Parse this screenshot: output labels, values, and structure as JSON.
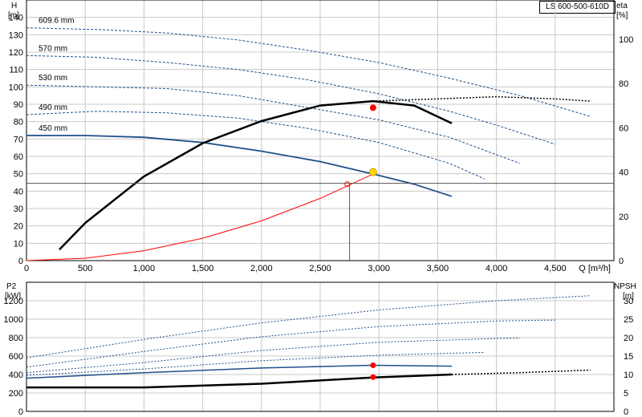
{
  "title": "LS 600-500-610D",
  "colors": {
    "curve": "#1f4f8b",
    "efficiency": "#000000",
    "system_curve": "#ff0000",
    "duty_point": "#ffd700",
    "marker": "#ff0000"
  },
  "chart_data": [
    {
      "type": "line",
      "panel": "head-efficiency",
      "xlabel": "Q [m³/h]",
      "ylabel_left": "H [m]",
      "ylabel_right": "eta [%]",
      "xlim": [
        0,
        5000
      ],
      "ylim_left": [
        0,
        150
      ],
      "ylim_right": [
        0,
        100
      ],
      "xticks": [
        "0",
        "500",
        "1,000",
        "1,500",
        "2,000",
        "2,500",
        "3,000",
        "3,500",
        "4,000",
        "4,500"
      ],
      "xtick_values": [
        0,
        500,
        1000,
        1500,
        2000,
        2500,
        3000,
        3500,
        4000,
        4500
      ],
      "yticks_left": [
        0,
        10,
        20,
        30,
        40,
        50,
        60,
        70,
        80,
        90,
        100,
        110,
        120,
        130,
        140
      ],
      "yticks_right": [
        0,
        20,
        40,
        60,
        80,
        100
      ],
      "grid": true,
      "impeller_curves": [
        {
          "label": "609.6 mm",
          "x": [
            0,
            600,
            1200,
            1800,
            2400,
            3000,
            3600,
            4200,
            4800
          ],
          "y": [
            134,
            133,
            131,
            127,
            121,
            114,
            105,
            95,
            83
          ]
        },
        {
          "label": "570 mm",
          "x": [
            0,
            600,
            1200,
            1800,
            2400,
            3000,
            3600,
            4000,
            4500
          ],
          "y": [
            118,
            117,
            114,
            110,
            104,
            96,
            86,
            78,
            67
          ]
        },
        {
          "label": "530 mm",
          "x": [
            0,
            600,
            1200,
            1800,
            2400,
            3000,
            3600,
            4200
          ],
          "y": [
            101,
            100,
            99,
            95,
            88,
            81,
            71,
            56
          ]
        },
        {
          "label": "490 mm",
          "x": [
            0,
            600,
            1200,
            1800,
            2400,
            3000,
            3600,
            3900
          ],
          "y": [
            84,
            86,
            85,
            82,
            76,
            68,
            56,
            47
          ]
        },
        {
          "label": "450 mm",
          "x": [
            0,
            500,
            1000,
            1500,
            2000,
            2500,
            3000,
            3300,
            3620
          ],
          "y": [
            72,
            72,
            71,
            68,
            63,
            57,
            49,
            44,
            37
          ]
        }
      ],
      "selected_curve_solid_until": 3620,
      "efficiency_curve": {
        "x": [
          280,
          500,
          1000,
          1500,
          2000,
          2500,
          2950,
          3300,
          3620
        ],
        "y": [
          5,
          17,
          38,
          53,
          63,
          70,
          72,
          70,
          62
        ]
      },
      "efficiency_extension": {
        "x": [
          2950,
          3500,
          4000,
          4500,
          4800
        ],
        "y": [
          72,
          73,
          74,
          73,
          72
        ]
      },
      "system_curve": {
        "x": [
          0,
          500,
          1000,
          1500,
          2000,
          2500,
          2950
        ],
        "y": [
          0,
          1.4,
          5.7,
          12.9,
          22.9,
          35.8,
          49.8
        ]
      },
      "duty_point": {
        "x": 2950,
        "y": 51
      },
      "efficiency_point": {
        "x": 2950,
        "eta": 69
      },
      "system_marker": {
        "x": 2730,
        "y": 44
      },
      "reference_line": {
        "x": 2750,
        "y": 44.5
      }
    },
    {
      "type": "line",
      "panel": "power-npsh",
      "ylabel_left": "P2 [kW]",
      "ylabel_right": "NPSH [m]",
      "xlim": [
        0,
        5000
      ],
      "ylim_left": [
        0,
        1400
      ],
      "ylim_right": [
        0,
        35
      ],
      "yticks_left": [
        0,
        200,
        400,
        600,
        800,
        1000,
        1200
      ],
      "yticks_right": [
        0,
        5,
        10,
        15,
        20,
        25,
        30
      ],
      "grid": true,
      "power_curves": [
        {
          "x": [
            0,
            1000,
            2000,
            3000,
            4000,
            4800
          ],
          "y": [
            580,
            780,
            960,
            1100,
            1200,
            1255
          ]
        },
        {
          "x": [
            0,
            1000,
            2000,
            3000,
            4000,
            4500
          ],
          "y": [
            480,
            650,
            810,
            920,
            980,
            990
          ]
        },
        {
          "x": [
            0,
            1000,
            2000,
            3000,
            4000,
            4200
          ],
          "y": [
            420,
            530,
            660,
            750,
            790,
            795
          ]
        },
        {
          "x": [
            0,
            1000,
            2000,
            3000,
            3900
          ],
          "y": [
            390,
            460,
            550,
            610,
            640
          ]
        },
        {
          "x": [
            0,
            1000,
            2000,
            2950,
            3620
          ],
          "y": [
            360,
            420,
            470,
            500,
            490
          ]
        }
      ],
      "npsh_curve": {
        "x": [
          0,
          1000,
          2000,
          2950,
          3620
        ],
        "y": [
          6.5,
          6.5,
          7.5,
          9.2,
          10
        ]
      },
      "npsh_extension": {
        "x": [
          3620,
          4200,
          4800
        ],
        "y": [
          10,
          10.5,
          11.2
        ]
      },
      "power_marker": {
        "x": 2950,
        "y": 500
      },
      "npsh_marker": {
        "x": 2950,
        "y": 9.3
      }
    }
  ]
}
